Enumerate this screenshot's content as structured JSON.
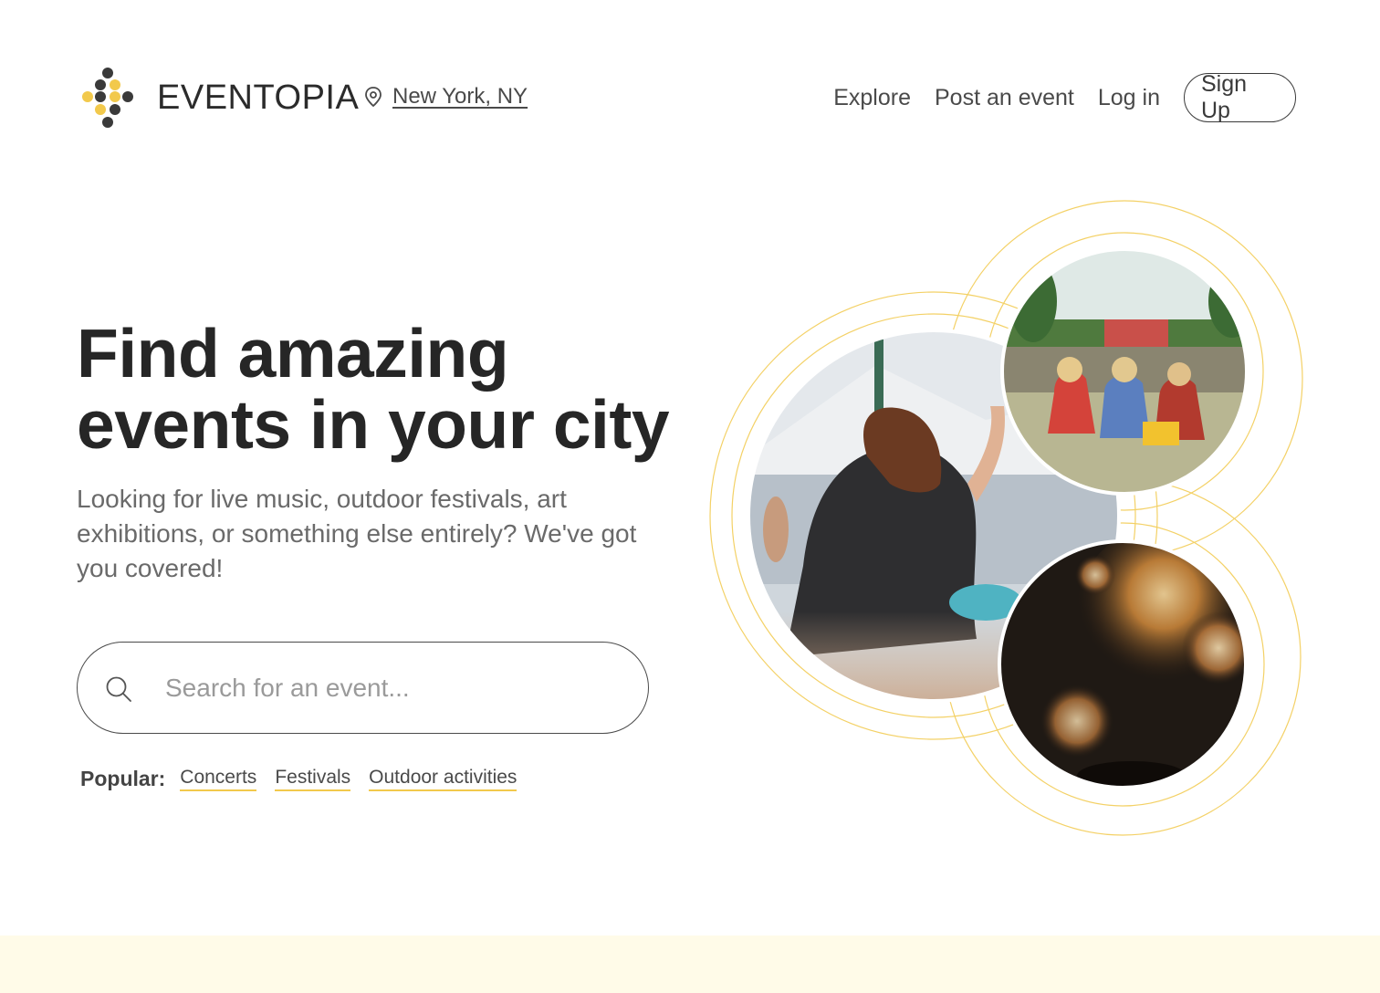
{
  "header": {
    "brand": "EVENTOPIA",
    "location": "New York, NY",
    "nav": {
      "explore": "Explore",
      "post_event": "Post an event",
      "login": "Log in",
      "signup": "Sign Up"
    }
  },
  "hero": {
    "title_line1": "Find amazing",
    "title_line2": "events in your city",
    "subtitle": "Looking for live music, outdoor festivals, art exhibitions, or something else entirely? We've got you covered!"
  },
  "search": {
    "placeholder": "Search for an event..."
  },
  "popular": {
    "label": "Popular:",
    "tags": [
      "Concerts",
      "Festivals",
      "Outdoor activities"
    ]
  },
  "colors": {
    "accent": "#f2c94c",
    "text_dark": "#262626",
    "footer_band": "#fffbe8"
  },
  "icons": {
    "logo": "eventopia-logo-icon",
    "location": "location-pin-icon",
    "search": "search-icon"
  }
}
